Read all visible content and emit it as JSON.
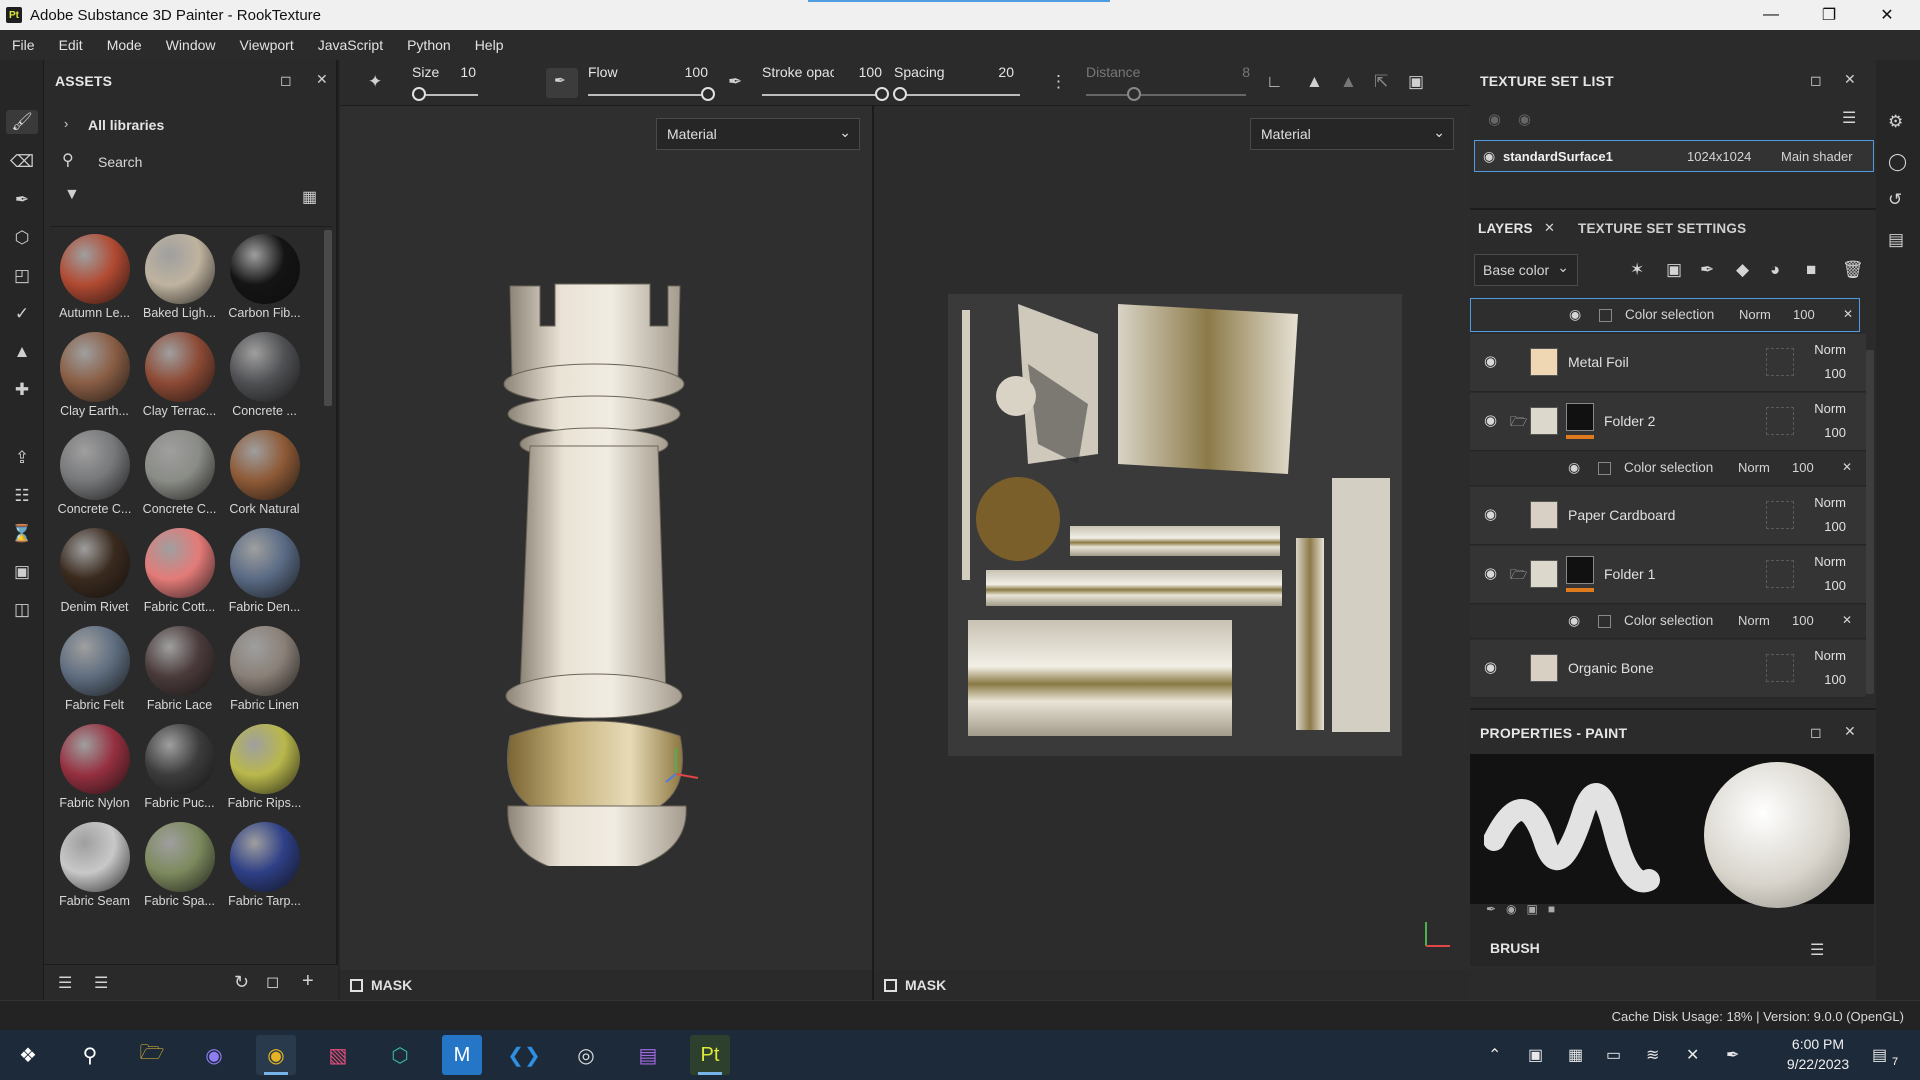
{
  "window": {
    "title": "Adobe Substance 3D Painter - RookTexture",
    "app_icon_text": "Pt",
    "controls": [
      "minimize",
      "restore",
      "close"
    ]
  },
  "menu": [
    "File",
    "Edit",
    "Mode",
    "Window",
    "Viewport",
    "JavaScript",
    "Python",
    "Help"
  ],
  "assets": {
    "title": "ASSETS",
    "library": "All libraries",
    "search_placeholder": "Search",
    "items": [
      {
        "label": "Autumn Le...",
        "color": "#b14a32"
      },
      {
        "label": "Baked Ligh...",
        "color": "#bfb39f"
      },
      {
        "label": "Carbon Fib...",
        "color": "#141414"
      },
      {
        "label": "Clay Earth...",
        "color": "#8a5e45"
      },
      {
        "label": "Clay Terrac...",
        "color": "#8d4a35"
      },
      {
        "label": "Concrete ...",
        "color": "#505154"
      },
      {
        "label": "Concrete C...",
        "color": "#77787a"
      },
      {
        "label": "Concrete C...",
        "color": "#8a8c86"
      },
      {
        "label": "Cork Natural",
        "color": "#8e5a37"
      },
      {
        "label": "Denim Rivet",
        "color": "#3a2a1e"
      },
      {
        "label": "Fabric Cott...",
        "color": "#e37b79"
      },
      {
        "label": "Fabric Den...",
        "color": "#5a6b85"
      },
      {
        "label": "Fabric Felt",
        "color": "#5f6e80"
      },
      {
        "label": "Fabric Lace",
        "color": "#4b3b3b"
      },
      {
        "label": "Fabric Linen",
        "color": "#8a8078"
      },
      {
        "label": "Fabric Nylon",
        "color": "#963040"
      },
      {
        "label": "Fabric Puc...",
        "color": "#3c3c3c"
      },
      {
        "label": "Fabric Rips...",
        "color": "#b9b84c"
      },
      {
        "label": "Fabric Seam",
        "color": "#c8c8c8"
      },
      {
        "label": "Fabric Spa...",
        "color": "#7d8a5e"
      },
      {
        "label": "Fabric Tarp...",
        "color": "#2e3f86"
      }
    ]
  },
  "brush_toolbar": {
    "size_label": "Size",
    "size_value": "10",
    "size_level": 0.1,
    "flow_label": "Flow",
    "flow_value": "100",
    "flow_level": 1.0,
    "stroke_label": "Stroke opac",
    "stroke_value": "100",
    "stroke_level": 1.0,
    "spacing_label": "Spacing",
    "spacing_value": "20",
    "spacing_level": 0.05,
    "distance_label": "Distance",
    "distance_value": "8",
    "distance_level": 0.3
  },
  "viewport_3d": {
    "channel": "Material",
    "mask_label": "MASK"
  },
  "viewport_2d": {
    "channel": "Material",
    "mask_label": "MASK"
  },
  "texture_set_list": {
    "title": "TEXTURE SET LIST",
    "set_name": "standardSurface1",
    "resolution": "1024x1024",
    "shader": "Main shader"
  },
  "layers": {
    "tab_layers": "LAYERS",
    "tab_settings": "TEXTURE SET SETTINGS",
    "channel": "Base color",
    "top_sub": {
      "label": "Color selection",
      "blend": "Norm",
      "opacity": "100"
    },
    "rows": [
      {
        "name": "Metal Foil",
        "blend": "Norm",
        "opacity": "100",
        "thumb": "#eed7b2",
        "folder": false
      },
      {
        "name": "Folder 2",
        "blend": "Norm",
        "opacity": "100",
        "thumb": "#ddd8cc",
        "folder": true
      },
      {
        "name": "Paper Cardboard",
        "blend": "Norm",
        "opacity": "100",
        "thumb": "#d9d0c5",
        "folder": false
      },
      {
        "name": "Folder 1",
        "blend": "Norm",
        "opacity": "100",
        "thumb": "#ddd8cc",
        "folder": true
      },
      {
        "name": "Organic Bone",
        "blend": "Norm",
        "opacity": "100",
        "thumb": "#d8d1c3",
        "folder": false
      }
    ],
    "sub_rows": [
      {
        "label": "Color selection",
        "blend": "Norm",
        "opacity": "100"
      },
      {
        "label": "Color selection",
        "blend": "Norm",
        "opacity": "100"
      }
    ]
  },
  "properties": {
    "title": "PROPERTIES - PAINT",
    "brush_label": "BRUSH"
  },
  "status": {
    "text": "Cache Disk Usage:  18% | Version: 9.0.0 (OpenGL)"
  },
  "taskbar": {
    "time": "6:00 PM",
    "date": "9/22/2023",
    "notifications": "7"
  },
  "colors": {
    "accent": "#4f9de0",
    "panel_bg": "#2b2b2b",
    "folder_marker": "#e07a1f"
  }
}
